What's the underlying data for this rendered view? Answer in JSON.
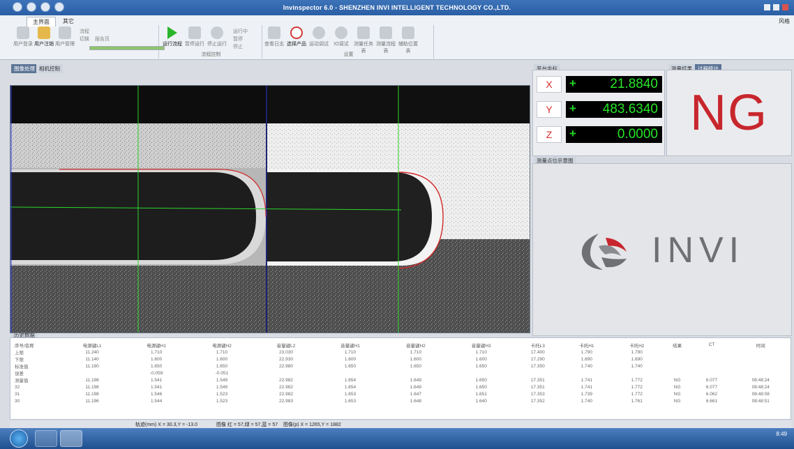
{
  "window": {
    "title": "Invinspector 6.0 - SHENZHEN INVI INTELLIGENT TECHNOLOGY CO.,LTD.",
    "style_label": "风格"
  },
  "ribbon": {
    "tabs": [
      "主界面",
      "其它"
    ],
    "user_buttons": [
      "用户登录",
      "用户注销",
      "用户管理"
    ],
    "user_subitems": [
      "流程",
      "切换",
      "报告页"
    ],
    "progress": 1.0,
    "flow_buttons": [
      "运行流程",
      "暂停运行",
      "停止运行"
    ],
    "flow_options": [
      "运行中",
      "暂停",
      "停止"
    ],
    "flow_group_label": "流程控制",
    "tool_buttons": [
      "查看日志",
      "选择产品",
      "运动调试",
      "IO调试",
      "测量任务表",
      "测量流程表",
      "辅助位置表"
    ],
    "tool_group_label": "设置"
  },
  "panels": {
    "image_tab": "图像处理",
    "camera_tab": "相机控制",
    "coord_tab": "平台坐标",
    "result_tab": "测量结果",
    "stats_tab": "过程统计",
    "position_tab": "测量点位示意图",
    "history_tab": "历史数据"
  },
  "coords": [
    {
      "axis": "X",
      "sign": "+",
      "value": "21.8840"
    },
    {
      "axis": "Y",
      "sign": "+",
      "value": "483.6340"
    },
    {
      "axis": "Z",
      "sign": "+",
      "value": "0.0000"
    }
  ],
  "result": {
    "status": "NG",
    "color": "#c8262d"
  },
  "logo": {
    "text": "INVI"
  },
  "history": {
    "headers": [
      "序号/名称",
      "电源键L1",
      "电源键H1",
      "电源键H2",
      "音量键L2",
      "音量键H1",
      "音量键H2",
      "音量键H3",
      "卡托L3",
      "卡托H1",
      "卡托H2",
      "结果",
      "CT",
      "时间"
    ],
    "rows": [
      [
        "上限",
        "11.240",
        "1.710",
        "1.710",
        "23.030",
        "1.710",
        "1.710",
        "1.710",
        "17.400",
        "1.790",
        "1.790",
        "",
        "",
        ""
      ],
      [
        "下限",
        "11.140",
        "1.600",
        "1.600",
        "22.930",
        "1.600",
        "1.600",
        "1.600",
        "17.290",
        "1.690",
        "1.690",
        "",
        "",
        ""
      ],
      [
        "标准值",
        "11.190",
        "1.650",
        "1.650",
        "22.980",
        "1.650",
        "1.650",
        "1.650",
        "17.350",
        "1.740",
        "1.740",
        "",
        "",
        ""
      ],
      [
        "误差",
        "",
        "-0.059",
        "-0.051",
        "",
        "",
        "",
        "",
        "",
        "",
        "",
        "",
        "",
        ""
      ],
      [
        "测量值",
        "11.198",
        "1.541",
        "1.549",
        "22.982",
        "1.654",
        "1.649",
        "1.650",
        "17.351",
        "1.741",
        "1.772",
        "NG",
        "6.077",
        "08:48:24"
      ],
      [
        "32",
        "11.198",
        "1.541",
        "1.549",
        "22.982",
        "1.654",
        "1.649",
        "1.650",
        "17.351",
        "1.741",
        "1.772",
        "NG",
        "6.077",
        "08:48:24"
      ],
      [
        "31",
        "11.198",
        "1.546",
        "1.523",
        "22.982",
        "1.653",
        "1.647",
        "1.651",
        "17.353",
        "1.739",
        "1.772",
        "NG",
        "6.062",
        "08:48:08"
      ],
      [
        "30",
        "11.196",
        "1.544",
        "1.523",
        "22.983",
        "1.653",
        "1.648",
        "1.640",
        "17.352",
        "1.740",
        "1.761",
        "NG",
        "6.661",
        "08:48:51"
      ]
    ]
  },
  "status": {
    "track": "轨迹(mm) X = 30.3,Y = -13.0",
    "image_rgb": "图像 红 = 57,绿 = 57,蓝 = 57",
    "image_pixel": "图像(p) X = 1265,Y = 1882"
  },
  "taskbar": {
    "time": "8:49"
  }
}
